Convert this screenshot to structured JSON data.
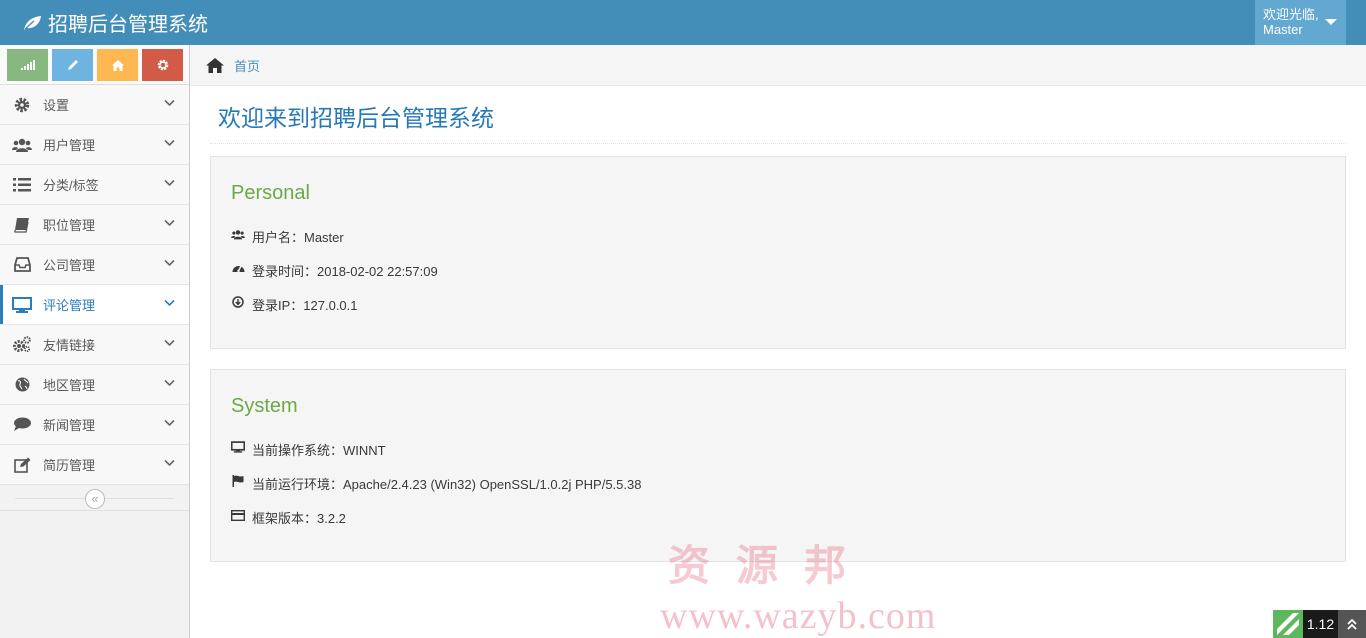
{
  "app": {
    "title": "招聘后台管理系统"
  },
  "user_menu": {
    "greeting": "欢迎光临,",
    "username": "Master"
  },
  "colors": {
    "navbar": "#438eb9",
    "accent": "#2b7dbc",
    "green": "#69aa46",
    "sc_success": "#87b87f",
    "sc_info": "#6fb3e0",
    "sc_warning": "#ffb752",
    "sc_danger": "#d15b47"
  },
  "shortcuts": [
    {
      "icon": "signal-icon"
    },
    {
      "icon": "pencil-icon"
    },
    {
      "icon": "home-icon"
    },
    {
      "icon": "gear-icon"
    }
  ],
  "sidebar": {
    "items": [
      {
        "label": "设置",
        "icon": "gear-icon"
      },
      {
        "label": "用户管理",
        "icon": "users-icon"
      },
      {
        "label": "分类/标签",
        "icon": "list-icon"
      },
      {
        "label": "职位管理",
        "icon": "book-icon"
      },
      {
        "label": "公司管理",
        "icon": "inbox-icon"
      },
      {
        "label": "评论管理",
        "icon": "desktop-icon",
        "active": true
      },
      {
        "label": "友情链接",
        "icon": "cogs-icon"
      },
      {
        "label": "地区管理",
        "icon": "globe-icon"
      },
      {
        "label": "新闻管理",
        "icon": "comment-icon"
      },
      {
        "label": "简历管理",
        "icon": "edit-icon"
      }
    ],
    "collapse_glyph": "«"
  },
  "breadcrumb": {
    "home": "首页"
  },
  "page": {
    "title": "欢迎来到招聘后台管理系统"
  },
  "personal": {
    "title": "Personal",
    "rows": [
      {
        "icon": "users-icon",
        "text": "用户名：Master"
      },
      {
        "icon": "dashboard-icon",
        "text": "登录时间：2018-02-02 22:57:09"
      },
      {
        "icon": "download-circle-icon",
        "text": "登录IP：127.0.0.1"
      }
    ]
  },
  "system": {
    "title": "System",
    "rows": [
      {
        "icon": "desktop-icon",
        "text": "当前操作系统：WINNT"
      },
      {
        "icon": "flag-icon",
        "text": "当前运行环境：Apache/2.4.23 (Win32) OpenSSL/1.0.2j PHP/5.5.38"
      },
      {
        "icon": "credit-card-icon",
        "text": "框架版本：3.2.2"
      }
    ]
  },
  "watermark": {
    "cn": "资源邦",
    "url": "www.wazyb.com"
  },
  "widgets": {
    "zoom": "1.12",
    "scroll_top_glyph": "⌃"
  }
}
